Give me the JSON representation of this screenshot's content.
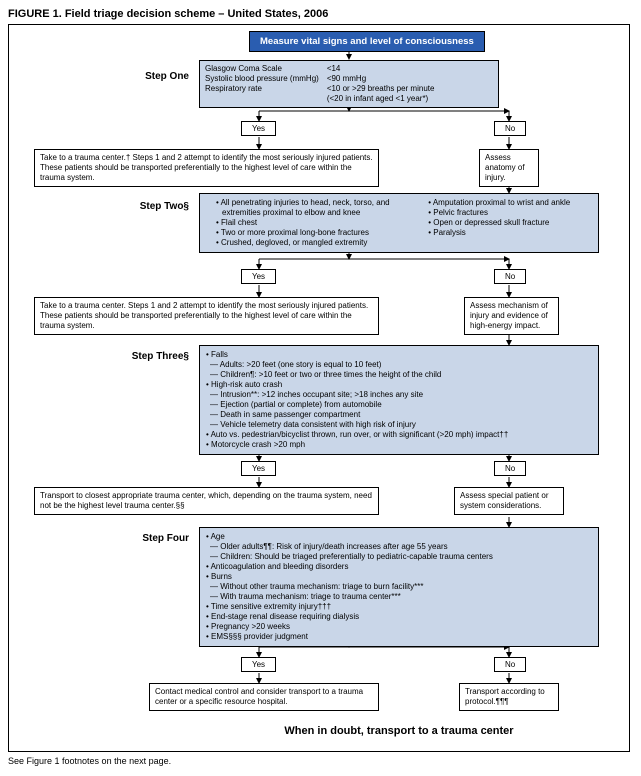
{
  "title": "FIGURE 1. Field triage decision scheme – United States, 2006",
  "header": "Measure vital signs and level of consciousness",
  "step1": {
    "label": "Step One",
    "rows": [
      [
        "Glasgow Coma Scale",
        "<14"
      ],
      [
        "Systolic blood pressure (mmHg)",
        "<90 mmHg"
      ],
      [
        "Respiratory rate",
        "<10 or >29 breaths per minute\n(<20 in infant aged <1 year*)"
      ]
    ]
  },
  "yes": "Yes",
  "no": "No",
  "take1": "Take to a trauma center.† Steps 1 and 2 attempt to identify the most seriously injured patients. These patients should be transported preferentially to the highest level of care within the trauma system.",
  "assess1": "Assess anatomy of injury.",
  "step2": {
    "label": "Step Two§",
    "left": [
      "All penetrating injuries to head, neck, torso, and extremities proximal to elbow and knee",
      "Flail chest",
      "Two or more proximal long-bone fractures",
      "Crushed, degloved, or mangled extremity"
    ],
    "right": [
      "Amputation proximal to wrist and ankle",
      "Pelvic fractures",
      "Open or depressed skull fracture",
      "Paralysis"
    ]
  },
  "take2": "Take to a trauma center. Steps 1 and 2 attempt to identify the most seriously injured patients. These patients should be transported preferentially to the highest level of care within the trauma system.",
  "assess2": "Assess mechanism of injury and evidence of high-energy impact.",
  "step3": {
    "label": "Step Three§",
    "items": [
      {
        "text": "Falls",
        "subs": [
          "Adults: >20 feet (one story is equal to 10 feet)",
          "Children¶: >10 feet or two or three times the height of the child"
        ]
      },
      {
        "text": "High-risk auto crash",
        "subs": [
          "Intrusion**: >12 inches occupant site; >18 inches any site",
          "Ejection (partial or complete) from automobile",
          "Death in same passenger compartment",
          "Vehicle telemetry data consistent with high risk of injury"
        ]
      },
      {
        "text": "Auto vs. pedestrian/bicyclist thrown, run over, or with significant (>20 mph) impact††"
      },
      {
        "text": "Motorcycle crash >20 mph"
      }
    ]
  },
  "take3": "Transport to closest appropriate trauma center, which, depending on the trauma system, need not be the highest level trauma center.§§",
  "assess3": "Assess special patient or system considerations.",
  "step4": {
    "label": "Step Four",
    "items": [
      {
        "text": "Age",
        "subs": [
          "Older adults¶¶: Risk of injury/death increases after age 55 years",
          "Children: Should be triaged preferentially to pediatric-capable trauma centers"
        ]
      },
      {
        "text": "Anticoagulation and bleeding disorders"
      },
      {
        "text": "Burns",
        "subs": [
          "Without other trauma mechanism: triage to burn facility***",
          "With trauma mechanism: triage to trauma center***"
        ]
      },
      {
        "text": "Time sensitive extremity injury†††"
      },
      {
        "text": "End-stage renal disease requiring dialysis"
      },
      {
        "text": "Pregnancy >20 weeks"
      },
      {
        "text": "EMS§§§ provider judgment"
      }
    ]
  },
  "contact": "Contact medical control and consider transport to a trauma center or a specific resource hospital.",
  "transport": "Transport according to protocol.¶¶¶",
  "bottom": "When in doubt, transport to a trauma center",
  "footnote": "See Figure 1 footnotes on the next page."
}
